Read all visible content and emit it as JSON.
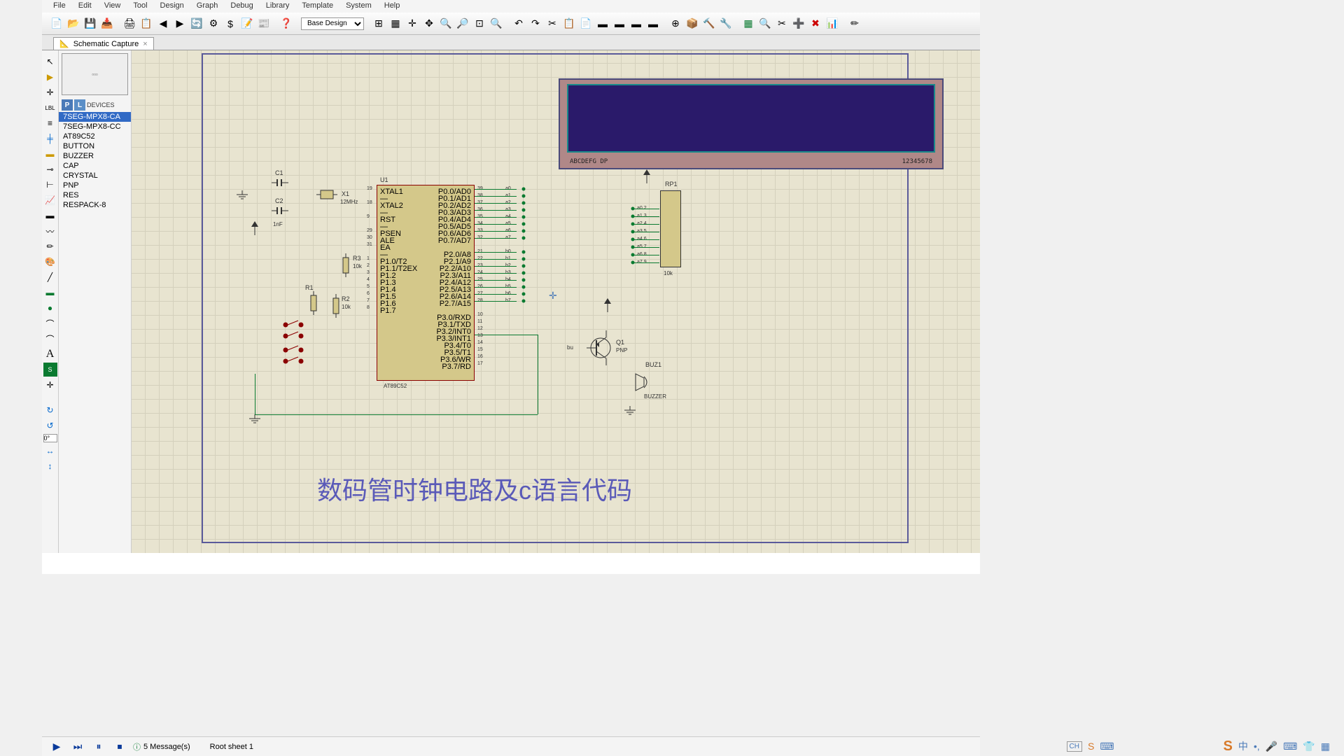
{
  "menu": {
    "file": "File",
    "edit": "Edit",
    "view": "View",
    "tool": "Tool",
    "design": "Design",
    "graph": "Graph",
    "debug": "Debug",
    "library": "Library",
    "template": "Template",
    "system": "System",
    "help": "Help"
  },
  "toolbar": {
    "variant": "Base Design"
  },
  "tab": {
    "title": "Schematic Capture",
    "close": "×"
  },
  "devices": {
    "header": "DEVICES",
    "items": [
      "7SEG-MPX8-CA",
      "7SEG-MPX8-CC",
      "AT89C52",
      "BUTTON",
      "BUZZER",
      "CAP",
      "CRYSTAL",
      "PNP",
      "RES",
      "RESPACK-8"
    ]
  },
  "rotation": "0°",
  "schematic": {
    "u1": {
      "ref": "U1",
      "part": "AT89C52",
      "left_pins": [
        [
          "19",
          "XTAL1"
        ],
        [
          "",
          "—"
        ],
        [
          "18",
          "XTAL2"
        ],
        [
          "",
          "—"
        ],
        [
          "9",
          "RST"
        ],
        [
          "",
          "—"
        ],
        [
          "29",
          "PSEN"
        ],
        [
          "30",
          "ALE"
        ],
        [
          "31",
          "EA"
        ],
        [
          "",
          "—"
        ],
        [
          "1",
          "P1.0/T2"
        ],
        [
          "2",
          "P1.1/T2EX"
        ],
        [
          "3",
          "P1.2"
        ],
        [
          "4",
          "P1.3"
        ],
        [
          "5",
          "P1.4"
        ],
        [
          "6",
          "P1.5"
        ],
        [
          "7",
          "P1.6"
        ],
        [
          "8",
          "P1.7"
        ]
      ],
      "right_pins": [
        [
          "39",
          "P0.0/AD0",
          "a0"
        ],
        [
          "38",
          "P0.1/AD1",
          "a1"
        ],
        [
          "37",
          "P0.2/AD2",
          "a2"
        ],
        [
          "36",
          "P0.3/AD3",
          "a3"
        ],
        [
          "35",
          "P0.4/AD4",
          "a4"
        ],
        [
          "34",
          "P0.5/AD5",
          "a5"
        ],
        [
          "33",
          "P0.6/AD6",
          "a6"
        ],
        [
          "32",
          "P0.7/AD7",
          "a7"
        ],
        [
          "",
          "",
          ""
        ],
        [
          "21",
          "P2.0/A8",
          "b0"
        ],
        [
          "22",
          "P2.1/A9",
          "b1"
        ],
        [
          "23",
          "P2.2/A10",
          "b2"
        ],
        [
          "24",
          "P2.3/A11",
          "b3"
        ],
        [
          "25",
          "P2.4/A12",
          "b4"
        ],
        [
          "26",
          "P2.5/A13",
          "b5"
        ],
        [
          "27",
          "P2.6/A14",
          "b6"
        ],
        [
          "28",
          "P2.7/A15",
          "b7"
        ],
        [
          "",
          "",
          ""
        ],
        [
          "10",
          "P3.0/RXD",
          ""
        ],
        [
          "11",
          "P3.1/TXD",
          ""
        ],
        [
          "12",
          "P3.2/INT0",
          ""
        ],
        [
          "13",
          "P3.3/INT1",
          ""
        ],
        [
          "14",
          "P3.4/T0",
          ""
        ],
        [
          "15",
          "P3.5/T1",
          ""
        ],
        [
          "16",
          "P3.6/WR",
          ""
        ],
        [
          "17",
          "P3.7/RD",
          ""
        ]
      ]
    },
    "c1": {
      "ref": "C1"
    },
    "c2": {
      "ref": "C2",
      "val": "1nF"
    },
    "x1": {
      "ref": "X1",
      "val": "12MHz"
    },
    "r1": {
      "ref": "R1"
    },
    "r2": {
      "ref": "R2",
      "val": "10k"
    },
    "r3": {
      "ref": "R3",
      "val": "10k"
    },
    "rp1": {
      "ref": "RP1",
      "val": "10k",
      "pins": [
        "a0 2",
        "a1 3",
        "a2 4",
        "a3 5",
        "a4 6",
        "a5 7",
        "a6 8",
        "a7 9"
      ]
    },
    "q1": {
      "ref": "Q1",
      "part": "PNP",
      "net": "bu"
    },
    "buz1": {
      "ref": "BUZ1",
      "part": "BUZZER"
    },
    "display": {
      "left": "ABCDEFG DP",
      "right": "12345678"
    },
    "caption": "数码管时钟电路及c语言代码"
  },
  "status": {
    "messages": "5 Message(s)",
    "sheet": "Root sheet 1"
  },
  "ime": {
    "lang": "CH"
  }
}
